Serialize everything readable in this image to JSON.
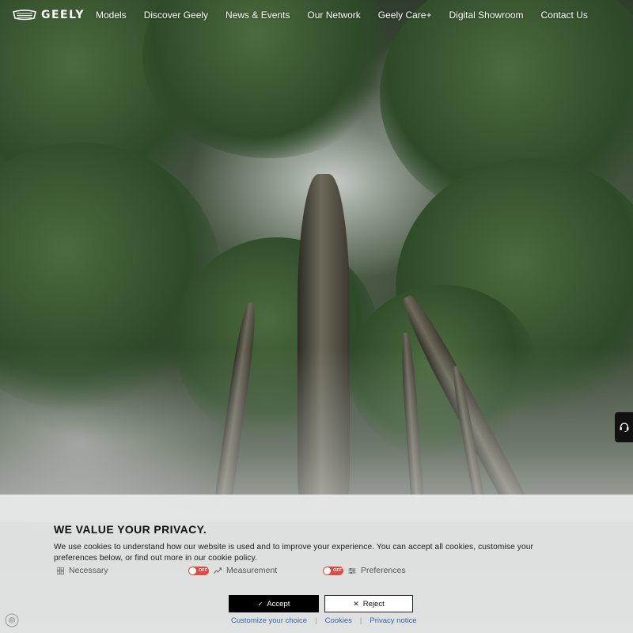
{
  "brand": {
    "logo_text": "GEELY"
  },
  "nav": {
    "items": [
      "Models",
      "Discover Geely",
      "News & Events",
      "Our Network",
      "Geely Care+",
      "Digital Showroom",
      "Contact Us"
    ]
  },
  "cookie": {
    "title": "WE VALUE YOUR PRIVACY.",
    "text": "We use cookies to understand how our website is used and to improve your experience. You can accept all cookies, customise your preferences below, or find out more in our cookie policy.",
    "categories": [
      {
        "label": "Necessary",
        "icon": "grid-icon"
      },
      {
        "label": "Measurement",
        "icon": "chart-line-icon",
        "toggle": "OFF"
      },
      {
        "label": "Preferences",
        "icon": "sliders-icon",
        "toggle": "OFF"
      }
    ],
    "accept_label": "Accept",
    "reject_label": "Reject",
    "links": [
      "Customize your choice",
      "Cookies",
      "Privacy notice"
    ],
    "separator": "|"
  },
  "colors": {
    "toggle_off": "#e04a45",
    "link": "#3a63a8",
    "accept_bg": "#000000"
  }
}
